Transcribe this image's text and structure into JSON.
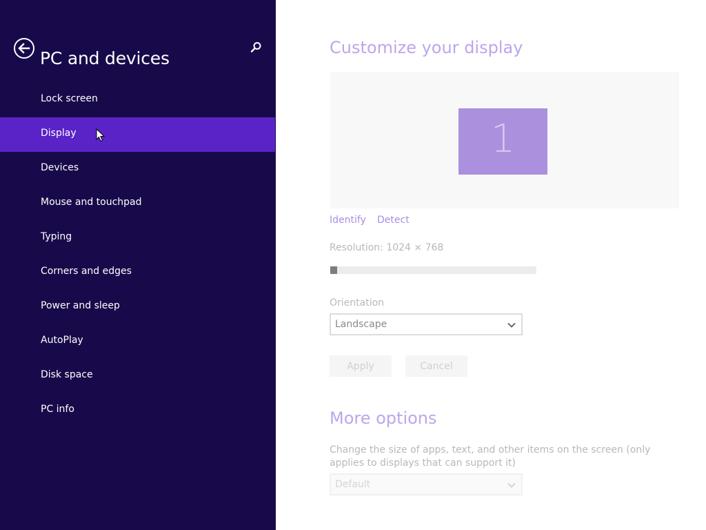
{
  "nav": {
    "title": "PC and devices",
    "back_icon": "back-arrow-icon",
    "search_icon": "search-icon",
    "selected_index": 1,
    "items": [
      {
        "label": "Lock screen"
      },
      {
        "label": "Display"
      },
      {
        "label": "Devices"
      },
      {
        "label": "Mouse and touchpad"
      },
      {
        "label": "Typing"
      },
      {
        "label": "Corners and edges"
      },
      {
        "label": "Power and sleep"
      },
      {
        "label": "AutoPlay"
      },
      {
        "label": "Disk space"
      },
      {
        "label": "PC info"
      }
    ]
  },
  "main": {
    "heading": "Customize your display",
    "monitor": {
      "number": "1"
    },
    "identify_label": "Identify",
    "detect_label": "Detect",
    "resolution_label": "Resolution: 1024 × 768",
    "resolution_slider_value": 0,
    "orientation": {
      "label": "Orientation",
      "selected": "Landscape"
    },
    "apply_label": "Apply",
    "cancel_label": "Cancel",
    "more_options": {
      "heading": "More options",
      "description": "Change the size of apps, text, and other items on the screen (only applies to displays that can support it)",
      "scale_selected": "Default"
    }
  },
  "colors": {
    "nav_background": "#180a4a",
    "nav_selected": "#5a23c8",
    "accent_text": "#bca6ec",
    "link": "#a98fe3",
    "monitor_tile": "#aa90dd"
  }
}
